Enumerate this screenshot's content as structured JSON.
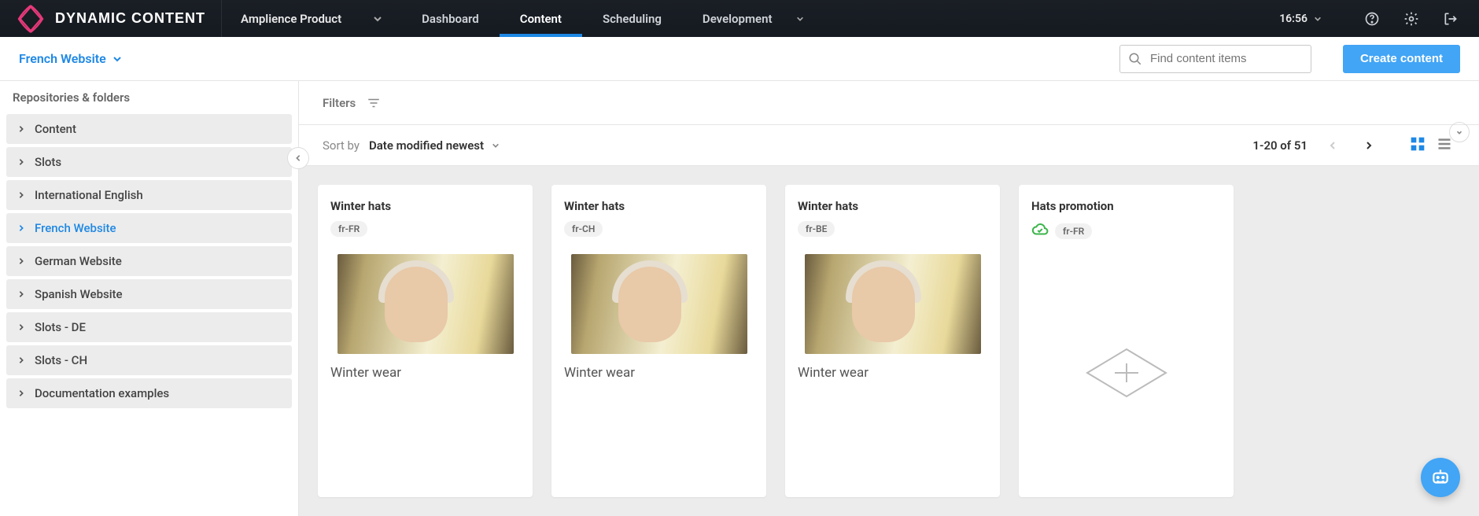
{
  "header": {
    "brand": "DYNAMIC CONTENT",
    "hub": "Amplience Product",
    "nav": [
      {
        "label": "Dashboard",
        "active": false
      },
      {
        "label": "Content",
        "active": true
      },
      {
        "label": "Scheduling",
        "active": false
      },
      {
        "label": "Development",
        "active": false,
        "hasDropdown": true
      }
    ],
    "time": "16:56"
  },
  "subheader": {
    "repo": "French Website",
    "search_placeholder": "Find content items",
    "create_label": "Create content"
  },
  "sidebar": {
    "heading": "Repositories & folders",
    "items": [
      {
        "label": "Content",
        "active": false
      },
      {
        "label": "Slots",
        "active": false
      },
      {
        "label": "International English",
        "active": false
      },
      {
        "label": "French Website",
        "active": true
      },
      {
        "label": "German Website",
        "active": false
      },
      {
        "label": "Spanish Website",
        "active": false
      },
      {
        "label": "Slots - DE",
        "active": false
      },
      {
        "label": "Slots - CH",
        "active": false
      },
      {
        "label": "Documentation examples",
        "active": false
      }
    ]
  },
  "content": {
    "filters_label": "Filters",
    "sort_label": "Sort by",
    "sort_value": "Date modified newest",
    "pager_text": "1-20 of 51",
    "active_view": "grid",
    "cards": [
      {
        "title": "Winter hats",
        "locale": "fr-FR",
        "delivery": false,
        "desc": "Winter wear",
        "hasImage": true
      },
      {
        "title": "Winter hats",
        "locale": "fr-CH",
        "delivery": false,
        "desc": "Winter wear",
        "hasImage": true
      },
      {
        "title": "Winter hats",
        "locale": "fr-BE",
        "delivery": false,
        "desc": "Winter wear",
        "hasImage": true
      },
      {
        "title": "Hats promotion",
        "locale": "fr-FR",
        "delivery": true,
        "desc": "",
        "hasImage": false
      }
    ]
  },
  "icons": {
    "search": "search-icon",
    "gear": "gear-icon",
    "help": "help-icon",
    "exit": "exit-icon",
    "filter": "filter-icon",
    "grid": "grid-view-icon",
    "list": "list-view-icon",
    "cloud": "cloud-check-icon",
    "bot": "chatbot-icon"
  },
  "colors": {
    "accent": "#1e88e5",
    "success": "#3bb54a"
  }
}
